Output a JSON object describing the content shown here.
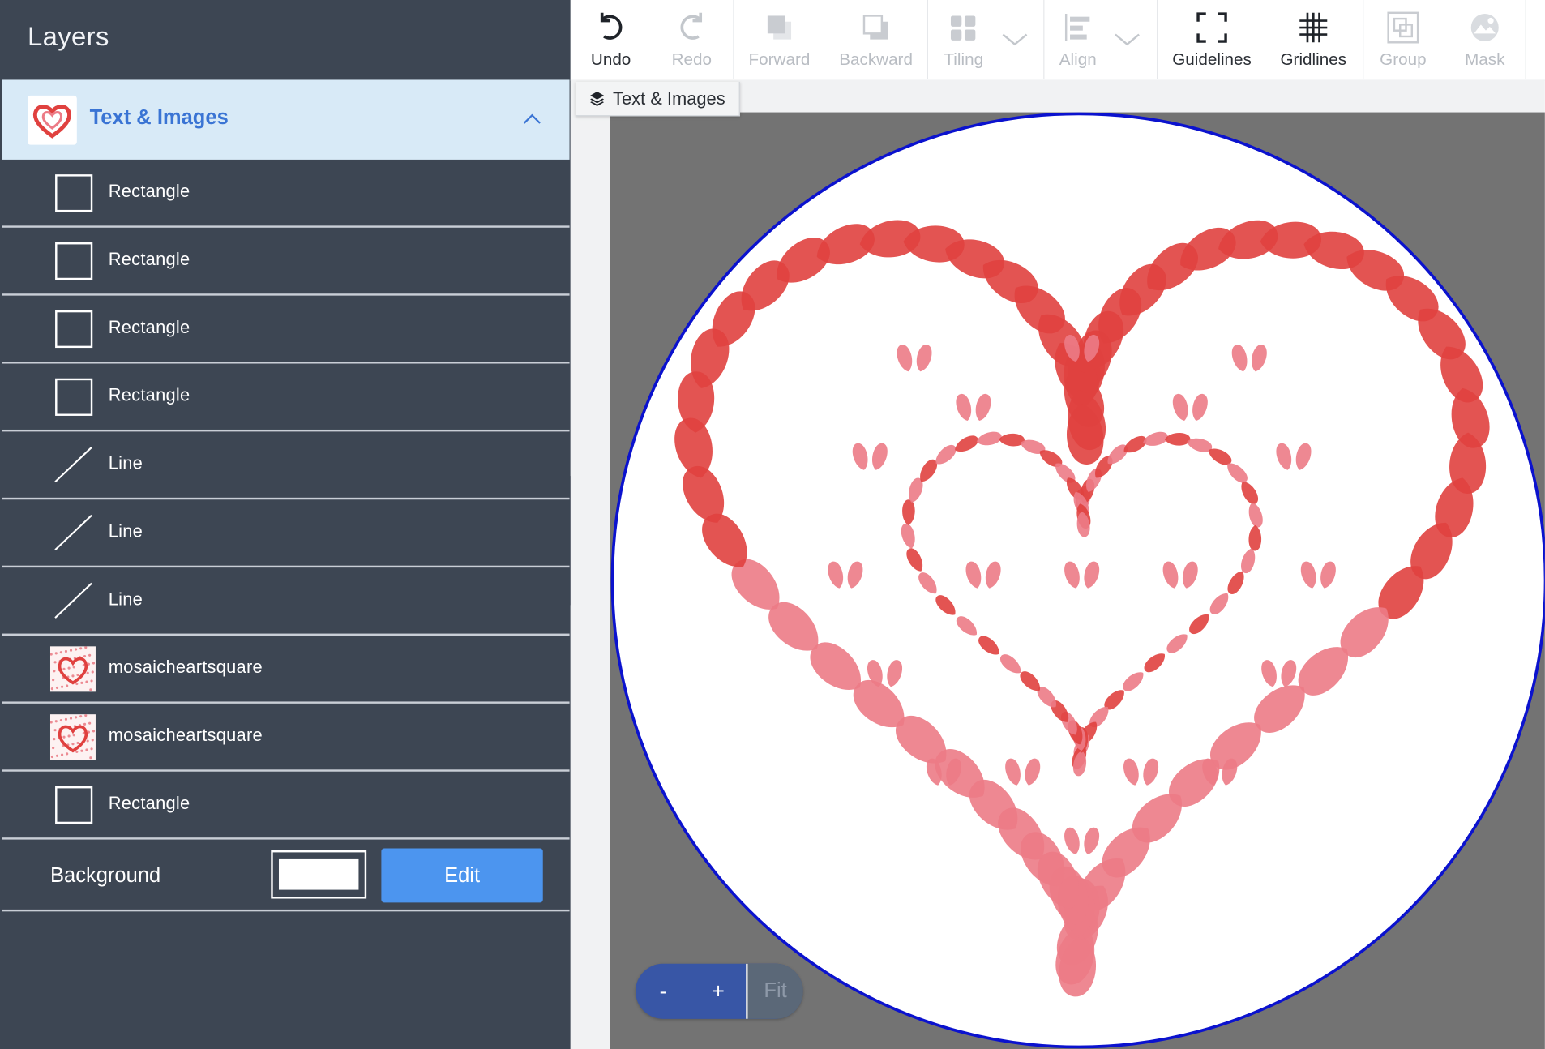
{
  "layers_panel": {
    "title": "Layers",
    "group": {
      "label": "Text & Images",
      "expanded": true
    },
    "items": [
      {
        "label": "Rectangle",
        "kind": "rectangle"
      },
      {
        "label": "Rectangle",
        "kind": "rectangle"
      },
      {
        "label": "Rectangle",
        "kind": "rectangle"
      },
      {
        "label": "Rectangle",
        "kind": "rectangle"
      },
      {
        "label": "Line",
        "kind": "line"
      },
      {
        "label": "Line",
        "kind": "line"
      },
      {
        "label": "Line",
        "kind": "line"
      },
      {
        "label": "mosaicheartsquare",
        "kind": "image"
      },
      {
        "label": "mosaicheartsquare",
        "kind": "image"
      },
      {
        "label": "Rectangle",
        "kind": "rectangle"
      }
    ],
    "background": {
      "label": "Background",
      "swatch_color": "#ffffff",
      "edit_label": "Edit"
    }
  },
  "toolbar": {
    "undo": "Undo",
    "redo": "Redo",
    "forward": "Forward",
    "backward": "Backward",
    "tiling": "Tiling",
    "align": "Align",
    "guidelines": "Guidelines",
    "gridlines": "Gridlines",
    "group": "Group",
    "mask": "Mask"
  },
  "breadcrumb": {
    "label": "Text & Images"
  },
  "zoom": {
    "out": "-",
    "in": "+",
    "fit": "Fit"
  },
  "colors": {
    "panel_bg": "#3d4653",
    "selected_bg": "#d8eaf7",
    "accent_blue": "#3a74d4",
    "edit_button": "#4c95ef",
    "canvas_border": "#0b12ce",
    "heart_red": "#e0413f",
    "heart_pink": "#ec7b86"
  }
}
